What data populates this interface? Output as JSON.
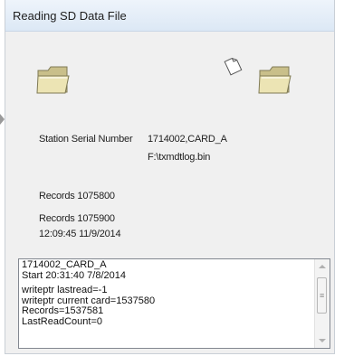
{
  "window": {
    "title": "Reading SD Data File"
  },
  "icons": {
    "source": "folder-icon",
    "document": "paper-icon",
    "target": "folder-icon"
  },
  "station": {
    "serial_label": "Station Serial Number",
    "serial_value": "1714002,CARD_A",
    "file_path": "F:\\txmdtlog.bin"
  },
  "records": {
    "first": "Records 1075800",
    "second": "Records 1075900",
    "timestamp": "12:09:45 11/9/2014"
  },
  "log": {
    "lines": [
      "1714002_CARD_A",
      "Start 20:31:40 7/8/2014",
      "",
      "writeptr lastread=-1",
      "writeptr current card=1537580",
      "Records=1537581",
      "LastReadCount=0"
    ]
  },
  "colors": {
    "folder": "#c9bf8a",
    "titlebar": "#e3edf7"
  }
}
